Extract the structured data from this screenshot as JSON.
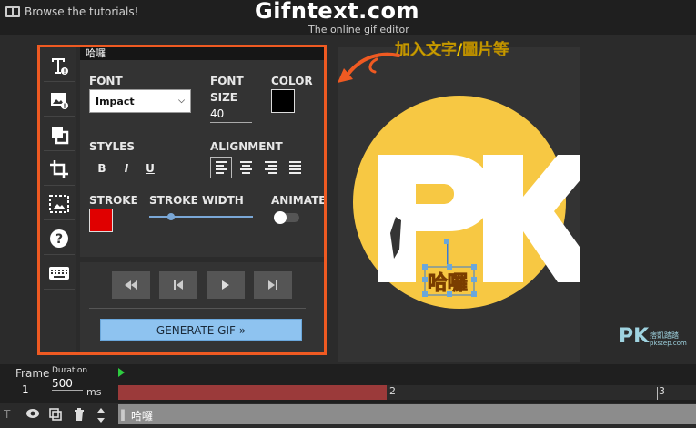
{
  "header": {
    "tutorials_label": "Browse the tutorials!",
    "brand": "Gifntext.com",
    "tagline": "The online gif editor"
  },
  "toolbar": {
    "items": [
      "text-tool",
      "image-tool",
      "shape-tool",
      "crop-tool",
      "canvas-tool",
      "help-tool",
      "keyboard-tool"
    ]
  },
  "settings": {
    "tab_label": "哈囉",
    "font_label": "FONT",
    "font_value": "Impact",
    "font_size_label_1": "FONT",
    "font_size_label_2": "SIZE",
    "font_size_value": "40",
    "color_label": "COLOR",
    "color_value": "#000000",
    "styles_label": "STYLES",
    "style_buttons": [
      "B",
      "I",
      "U"
    ],
    "alignment_label": "ALIGNMENT",
    "stroke_label": "STROKE",
    "stroke_color": "#e00000",
    "stroke_width_label": "STROKE WIDTH",
    "stroke_width_level": 0.2,
    "animate_label": "ANIMATE",
    "animate_on": false
  },
  "playback": {
    "buttons": [
      "rewind",
      "previous",
      "play",
      "next"
    ],
    "generate_label": "GENERATE GIF »"
  },
  "preview": {
    "logo_text": "PK",
    "text_layer": "哈囉",
    "watermark_top": "PK",
    "watermark_sub": "痞凱踏踏",
    "watermark_url": "pkstep.com"
  },
  "annotation": "加入文字/圖片等",
  "timeline": {
    "frame_label": "Frame",
    "frame_number": "1",
    "duration_label": "Duration",
    "duration_value": "500",
    "duration_unit": "ms",
    "tick_2": "2",
    "tick_3": "3",
    "layer_label": "哈囉",
    "accent": "#9b3a3a"
  }
}
